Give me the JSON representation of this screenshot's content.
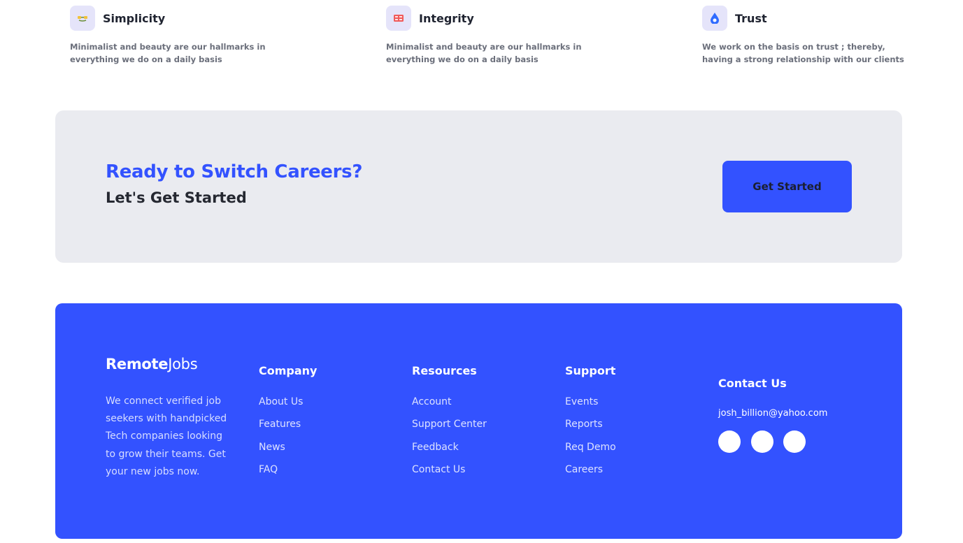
{
  "values": [
    {
      "icon": "smiley-icon",
      "title": "Simplicity",
      "desc": "Minimalist and beauty are our hallmarks in everything we do on a daily basis"
    },
    {
      "icon": "grid-icon",
      "title": "Integrity",
      "desc": "Minimalist and beauty are our hallmarks in everything we do on a daily basis"
    },
    {
      "icon": "drop-icon",
      "title": "Trust",
      "desc": "We work on the basis on trust ; thereby, having a strong relationship with our clients"
    }
  ],
  "cta": {
    "heading": "Ready to Switch Careers?",
    "subheading": "Let's Get Started",
    "button_label": "Get Started"
  },
  "footer": {
    "brand_bold": "Remote",
    "brand_light": "Jobs",
    "description": "We connect verified job seekers with handpicked Tech companies looking to grow their teams. Get your new jobs now.",
    "columns": [
      {
        "title": "Company",
        "links": [
          "About Us",
          "Features",
          "News",
          "FAQ"
        ]
      },
      {
        "title": "Resources",
        "links": [
          "Account",
          "Support Center",
          "Feedback",
          "Contact Us"
        ]
      },
      {
        "title": "Support",
        "links": [
          "Events",
          "Reports",
          "Req Demo",
          "Careers"
        ]
      }
    ],
    "contact": {
      "title": "Contact Us",
      "email": "josh_billion@yahoo.com",
      "socials": [
        "social-link-1",
        "social-link-2",
        "social-link-3"
      ]
    }
  },
  "colors": {
    "accent": "#3352ff",
    "cta_background": "#eaebf0",
    "icon_tile": "#e5e4fa"
  }
}
